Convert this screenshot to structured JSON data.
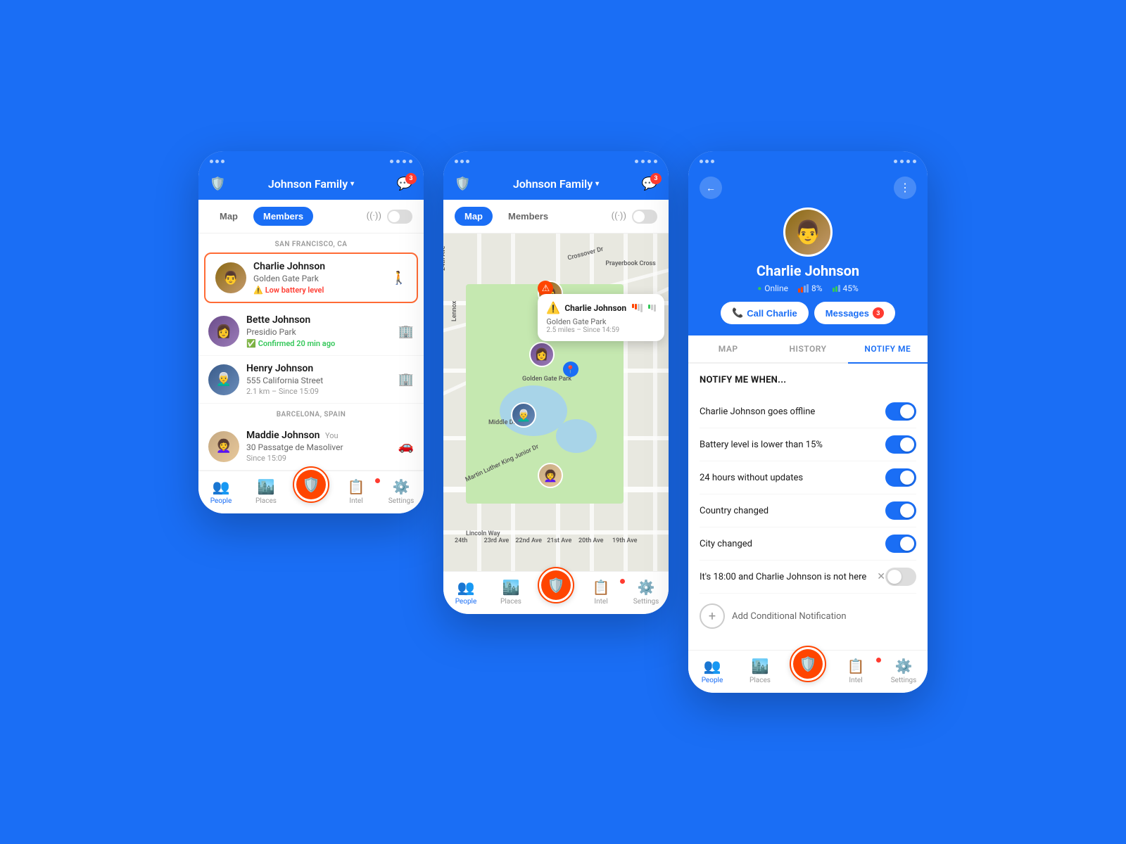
{
  "app": {
    "title": "Johnson Family",
    "chat_badge": "3",
    "status_bar_dots": [
      "•",
      "•",
      "•"
    ]
  },
  "phone1": {
    "tabs": {
      "map": "Map",
      "members": "Members"
    },
    "location_sf": "SAN FRANCISCO, CA",
    "location_bcn": "BARCELONA, SPAIN",
    "members": [
      {
        "name": "Charlie Johnson",
        "location": "Golden Gate Park",
        "status_type": "low_battery",
        "status_text": "Low battery level",
        "icon": "🚶",
        "highlighted": true
      },
      {
        "name": "Bette Johnson",
        "location": "Presidio Park",
        "status_type": "confirmed",
        "status_text": "Confirmed 20 min ago",
        "icon": "🏢"
      },
      {
        "name": "Henry Johnson",
        "location": "555 California Street",
        "distance": "2.1 km – Since 15:09",
        "icon": "🏢"
      },
      {
        "name": "Maddie Johnson",
        "tag": "You",
        "location": "30 Passatge de Masoliver",
        "distance": "Since 15:09",
        "icon": "🚗"
      }
    ],
    "nav": {
      "people": "People",
      "places": "Places",
      "intel": "Intel",
      "settings": "Settings"
    }
  },
  "phone2": {
    "map_popup": {
      "name": "Charlie Johnson",
      "place": "Golden Gate Park",
      "detail": "2.5 miles – Since 14:59"
    }
  },
  "phone3": {
    "profile": {
      "name": "Charlie Johnson",
      "status": "Online",
      "signal": "8%",
      "battery": "45%",
      "call_label": "Call Charlie",
      "messages_label": "Messages",
      "messages_badge": "3"
    },
    "tabs": {
      "map": "MAP",
      "history": "HISTORY",
      "notify": "NOTIFY ME"
    },
    "notify": {
      "title": "NOTIFY ME WHEN...",
      "items": [
        {
          "text": "Charlie Johnson goes offline",
          "on": true
        },
        {
          "text": "Battery level is lower than 15%",
          "on": true
        },
        {
          "text": "24 hours without updates",
          "on": true
        },
        {
          "text": "Country changed",
          "on": true
        },
        {
          "text": "City changed",
          "on": true
        },
        {
          "text": "It's 18:00 and Charlie Johnson is not here",
          "on": false,
          "removable": true
        }
      ],
      "add_label": "Add Conditional Notification"
    },
    "nav": {
      "people": "People",
      "places": "Places",
      "intel": "Intel",
      "settings": "Settings"
    }
  }
}
